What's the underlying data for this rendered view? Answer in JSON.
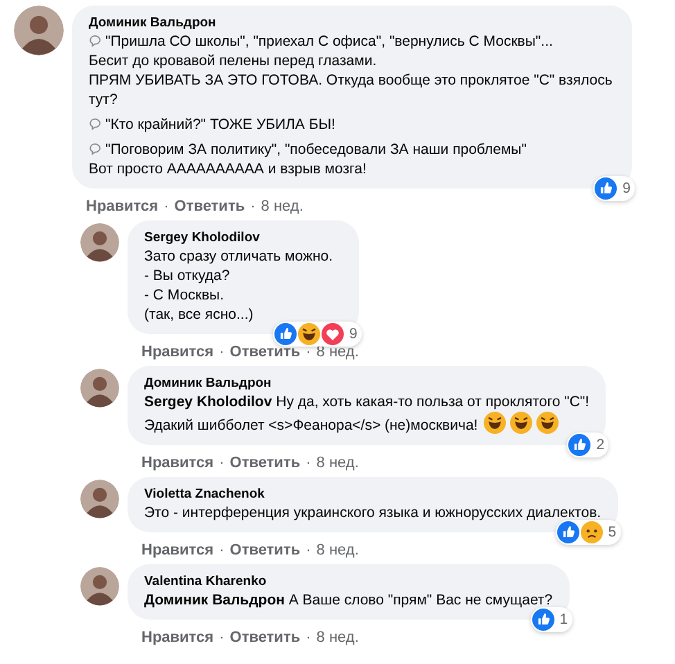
{
  "comments": [
    {
      "author": "Доминик Вальдрон",
      "reply": false,
      "paragraphs": [
        {
          "icon": true,
          "text": "\"Пришла СО школы\", \"приехал С офиса\", \"вернулись С Москвы\"...\nБесит до кровавой пелены перед глазами.\nПРЯМ УБИВАТЬ ЗА ЭТО ГОТОВА. Откуда вообще это проклятое \"С\" взялось тут?"
        },
        {
          "icon": true,
          "text": "\"Кто крайний?\" ТОЖЕ УБИЛА БЫ!"
        },
        {
          "icon": true,
          "text": "\"Поговорим ЗА политику\", \"побеседовали ЗА наши проблемы\"\nВот просто АААААААААА и взрыв мозга!"
        }
      ],
      "reactions": [
        {
          "kind": "like"
        }
      ],
      "count": "9",
      "actions": {
        "like": "Нравится",
        "separator": "·",
        "reply": "Ответить",
        "time": "8 нед."
      }
    },
    {
      "author": "Sergey Kholodilov",
      "reply": true,
      "paragraphs": [
        {
          "icon": false,
          "text": "Зато сразу отличать можно.\n- Вы откуда?\n- С Москвы.\n(так, все ясно...)"
        }
      ],
      "reactions": [
        {
          "kind": "like"
        },
        {
          "kind": "haha"
        },
        {
          "kind": "love"
        }
      ],
      "count": "9",
      "actions": {
        "like": "Нравится",
        "separator": "·",
        "reply": "Ответить",
        "time": "8 нед."
      }
    },
    {
      "author": "Доминик Вальдрон",
      "reply": true,
      "paragraphs": [
        {
          "icon": false,
          "text": "**Sergey Kholodilov** Ну да, хоть какая-то польза от проклятого \"С\"!\nЭдакий шибболет <s>Феанора</s> (не)москвича!"
        }
      ],
      "trailing_emojis": [
        {
          "kind": "laugh"
        },
        {
          "kind": "laugh"
        },
        {
          "kind": "laugh"
        }
      ],
      "reactions": [
        {
          "kind": "like"
        }
      ],
      "count": "2",
      "actions": {
        "like": "Нравится",
        "separator": "·",
        "reply": "Ответить",
        "time": "8 нед."
      }
    },
    {
      "author": "Violetta Znachenok",
      "reply": true,
      "paragraphs": [
        {
          "icon": false,
          "text": "Это - интерференция украинского языка и южнорусских диалектов."
        }
      ],
      "reactions": [
        {
          "kind": "like"
        },
        {
          "kind": "sad"
        }
      ],
      "count": "5",
      "actions": {
        "like": "Нравится",
        "separator": "·",
        "reply": "Ответить",
        "time": "8 нед."
      }
    },
    {
      "author": "Valentina Kharenko",
      "reply": true,
      "paragraphs": [
        {
          "icon": false,
          "text": "**Доминик Вальдрон** А Ваше слово \"прям\" Вас не смущает?"
        }
      ],
      "reactions": [
        {
          "kind": "like"
        }
      ],
      "count": "1",
      "actions": {
        "like": "Нравится",
        "separator": "·",
        "reply": "Ответить",
        "time": "8 нед."
      }
    }
  ]
}
